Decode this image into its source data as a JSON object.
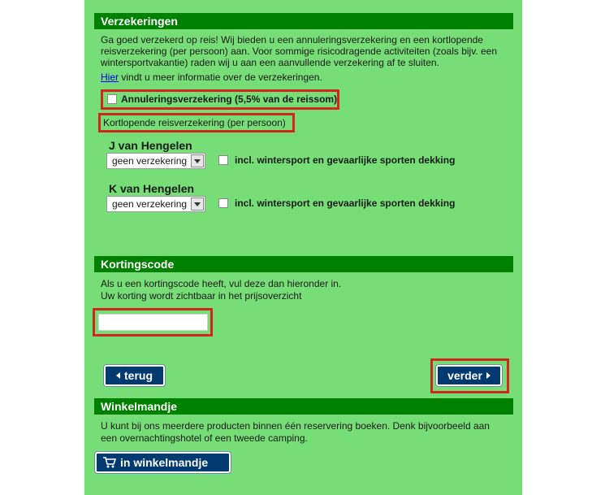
{
  "insurance": {
    "header": "Verzekeringen",
    "intro_line1": "Ga goed verzekerd op reis! Wij bieden u een annuleringsverzekering en een kortlopende",
    "intro_line2": "reisverzekering (per persoon) aan. Voor sommige risicodragende activiteiten (zoals bijv. een",
    "intro_line3": "wintersportvakantie) raden wij u aan een aanvullende verzekering af te sluiten.",
    "info_link": "Hier",
    "info_rest": " vindt u meer informatie over de verzekeringen.",
    "cancellation_label": "Annuleringsverzekering (5,5% van de reissom)",
    "cancellation_checked": false,
    "short_term_label": "Kortlopende reisverzekering (per persoon)",
    "persons": [
      {
        "name": "J van Hengelen",
        "selected_option": "geen verzekering",
        "winter_label": "incl. wintersport en gevaarlijke sporten dekking",
        "winter_checked": false
      },
      {
        "name": "K van Hengelen",
        "selected_option": "geen verzekering",
        "winter_label": "incl. wintersport en gevaarlijke sporten dekking",
        "winter_checked": false
      }
    ]
  },
  "discount": {
    "header": "Kortingscode",
    "text_line1": "Als u een kortingscode heeft, vul deze dan hieronder in.",
    "text_line2": "Uw korting wordt zichtbaar in het prijsoverzicht",
    "input_value": ""
  },
  "navigation": {
    "back_label": "terug",
    "next_label": "verder"
  },
  "cart": {
    "header": "Winkelmandje",
    "text_line1": "U kunt bij ons meerdere producten binnen één reservering boeken. Denk bijvoorbeeld aan",
    "text_line2": "een overnachtingshotel of een tweede camping.",
    "button_label": "in winkelmandje"
  },
  "colors": {
    "panel_bg": "#77dd77",
    "header_bg": "#008000",
    "button_bg": "#003a70",
    "highlight_border": "#d0281e"
  }
}
